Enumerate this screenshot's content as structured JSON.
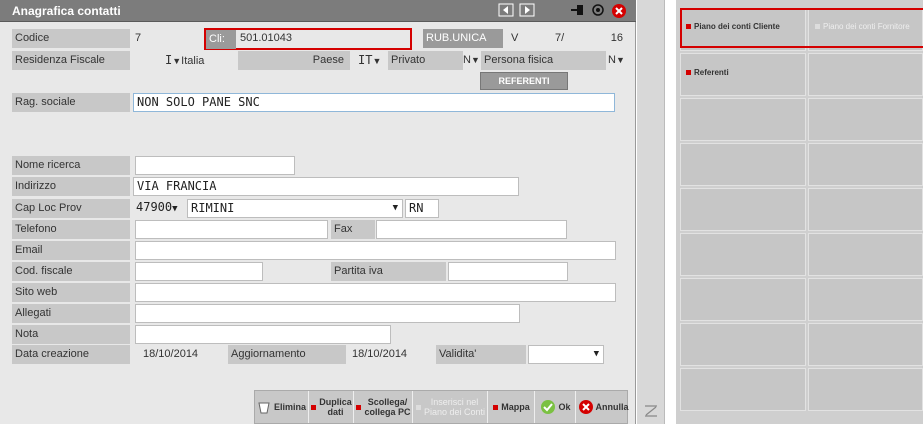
{
  "window": {
    "title": "Anagrafica contatti",
    "titlebar_icons": [
      "arrow-left-icon",
      "arrow-right-icon",
      "pin-icon",
      "radio-icon",
      "close-icon"
    ]
  },
  "header": {
    "codice_label": "Codice",
    "codice_value": "7",
    "cli_label": "Cli:",
    "cli_value": "501.01043",
    "rub_label": "RUB.UNICA",
    "rub_v": "V",
    "rub_num": "7/",
    "rub_count": "16"
  },
  "residenza": {
    "label": "Residenza Fiscale",
    "value_code": "I",
    "value_text": "Italia",
    "paese_label": "Paese",
    "paese_value": "IT",
    "privato_label": "Privato",
    "privato_value": "N",
    "persona_label": "Persona fisica",
    "persona_value": "N"
  },
  "referenti_button": "REFERENTI",
  "fields": {
    "rag_sociale_label": "Rag. sociale",
    "rag_sociale_value": "NON SOLO PANE SNC",
    "nome_ricerca_label": "Nome ricerca",
    "nome_ricerca_value": "",
    "indirizzo_label": "Indirizzo",
    "indirizzo_value": "VIA FRANCIA",
    "cap_label": "Cap Loc Prov",
    "cap_value": "47900",
    "loc_value": "RIMINI",
    "prov_value": "RN",
    "telefono_label": "Telefono",
    "telefono_value": "",
    "fax_label": "Fax",
    "fax_value": "",
    "email_label": "Email",
    "email_value": "",
    "cod_fiscale_label": "Cod. fiscale",
    "cod_fiscale_value": "",
    "partita_iva_label": "Partita iva",
    "partita_iva_value": "",
    "sito_web_label": "Sito web",
    "sito_web_value": "",
    "allegati_label": "Allegati",
    "allegati_value": "",
    "nota_label": "Nota",
    "nota_value": "",
    "data_creazione_label": "Data creazione",
    "data_creazione_value": "18/10/2014",
    "aggiornamento_label": "Aggiornamento",
    "aggiornamento_value": "18/10/2014",
    "validita_label": "Validita'",
    "validita_value": ""
  },
  "bottom_buttons": {
    "elimina": "Elimina",
    "duplica_1": "Duplica",
    "duplica_2": "dati",
    "scollega_1": "Scollega/",
    "scollega_2": "collega PC",
    "inserisci_1": "Inserisci nel",
    "inserisci_2": "Piano dei Conti",
    "mappa": "Mappa",
    "ok": "Ok",
    "annulla": "Annulla"
  },
  "right_panel": {
    "piano_cliente": "Piano dei conti Cliente",
    "piano_fornitore": "Piano dei conti Fornitore",
    "referenti": "Referenti"
  },
  "colors": {
    "accent_red": "#d40000",
    "title_bg": "#7c7c7c",
    "label_bg": "#c8c8c8"
  }
}
